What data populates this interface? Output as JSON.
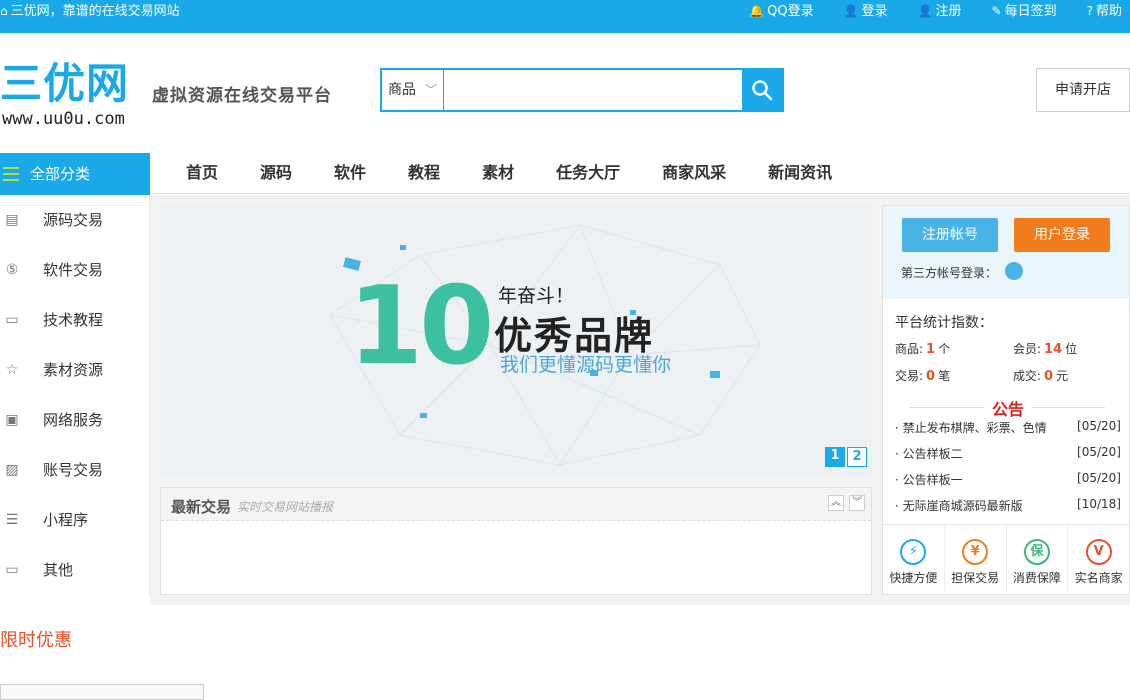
{
  "topbar": {
    "slogan": "三优网，靠谱的在线交易网站",
    "links": [
      "QQ登录",
      "登录",
      "注册",
      "每日签到",
      "帮助"
    ]
  },
  "header": {
    "logo_text": "三优网",
    "logo_url": "www.uu0u.com",
    "subtitle": "虚拟资源在线交易平台",
    "search": {
      "category": "商品",
      "placeholder": ""
    },
    "apply_label": "申请开店"
  },
  "nav": {
    "all_categories": "全部分类",
    "items": [
      "首页",
      "源码",
      "软件",
      "教程",
      "素材",
      "任务大厅",
      "商家风采",
      "新闻资讯"
    ]
  },
  "sidebar": {
    "items": [
      "源码交易",
      "软件交易",
      "技术教程",
      "素材资源",
      "网络服务",
      "账号交易",
      "小程序",
      "其他"
    ]
  },
  "banner": {
    "number": "10",
    "years": "年奋斗！",
    "brand": "优秀品牌",
    "tagline": "我们更懂源码更懂你",
    "pages": [
      "1",
      "2"
    ]
  },
  "latest": {
    "title": "最新交易",
    "subtitle": "实时交易网站播报"
  },
  "right": {
    "register": "注册帐号",
    "login": "用户登录",
    "third_party": "第三方帐号登录：",
    "stats_title": "平台统计指数：",
    "stats": [
      {
        "label": "商品:",
        "value": "1",
        "unit": "个"
      },
      {
        "label": "会员:",
        "value": "14",
        "unit": "位"
      },
      {
        "label": "交易:",
        "value": "0",
        "unit": "笔"
      },
      {
        "label": "成交:",
        "value": "0",
        "unit": "元"
      }
    ],
    "notice_title": "公告",
    "notices": [
      {
        "text": "禁止发布棋牌、彩票、色情",
        "date": "[05/20]"
      },
      {
        "text": "公告样板二",
        "date": "[05/20]"
      },
      {
        "text": "公告样板一",
        "date": "[05/20]"
      },
      {
        "text": "无际崖商城源码最新版",
        "date": "[10/18]"
      }
    ],
    "features": [
      {
        "label": "快捷方便",
        "glyph": "⚡",
        "color": "#1aa9e8"
      },
      {
        "label": "担保交易",
        "glyph": "¥",
        "color": "#f07c1e"
      },
      {
        "label": "消费保障",
        "glyph": "保",
        "color": "#3cb878"
      },
      {
        "label": "实名商家",
        "glyph": "V",
        "color": "#e8522b"
      }
    ]
  },
  "promo": {
    "title": "限时优惠"
  }
}
